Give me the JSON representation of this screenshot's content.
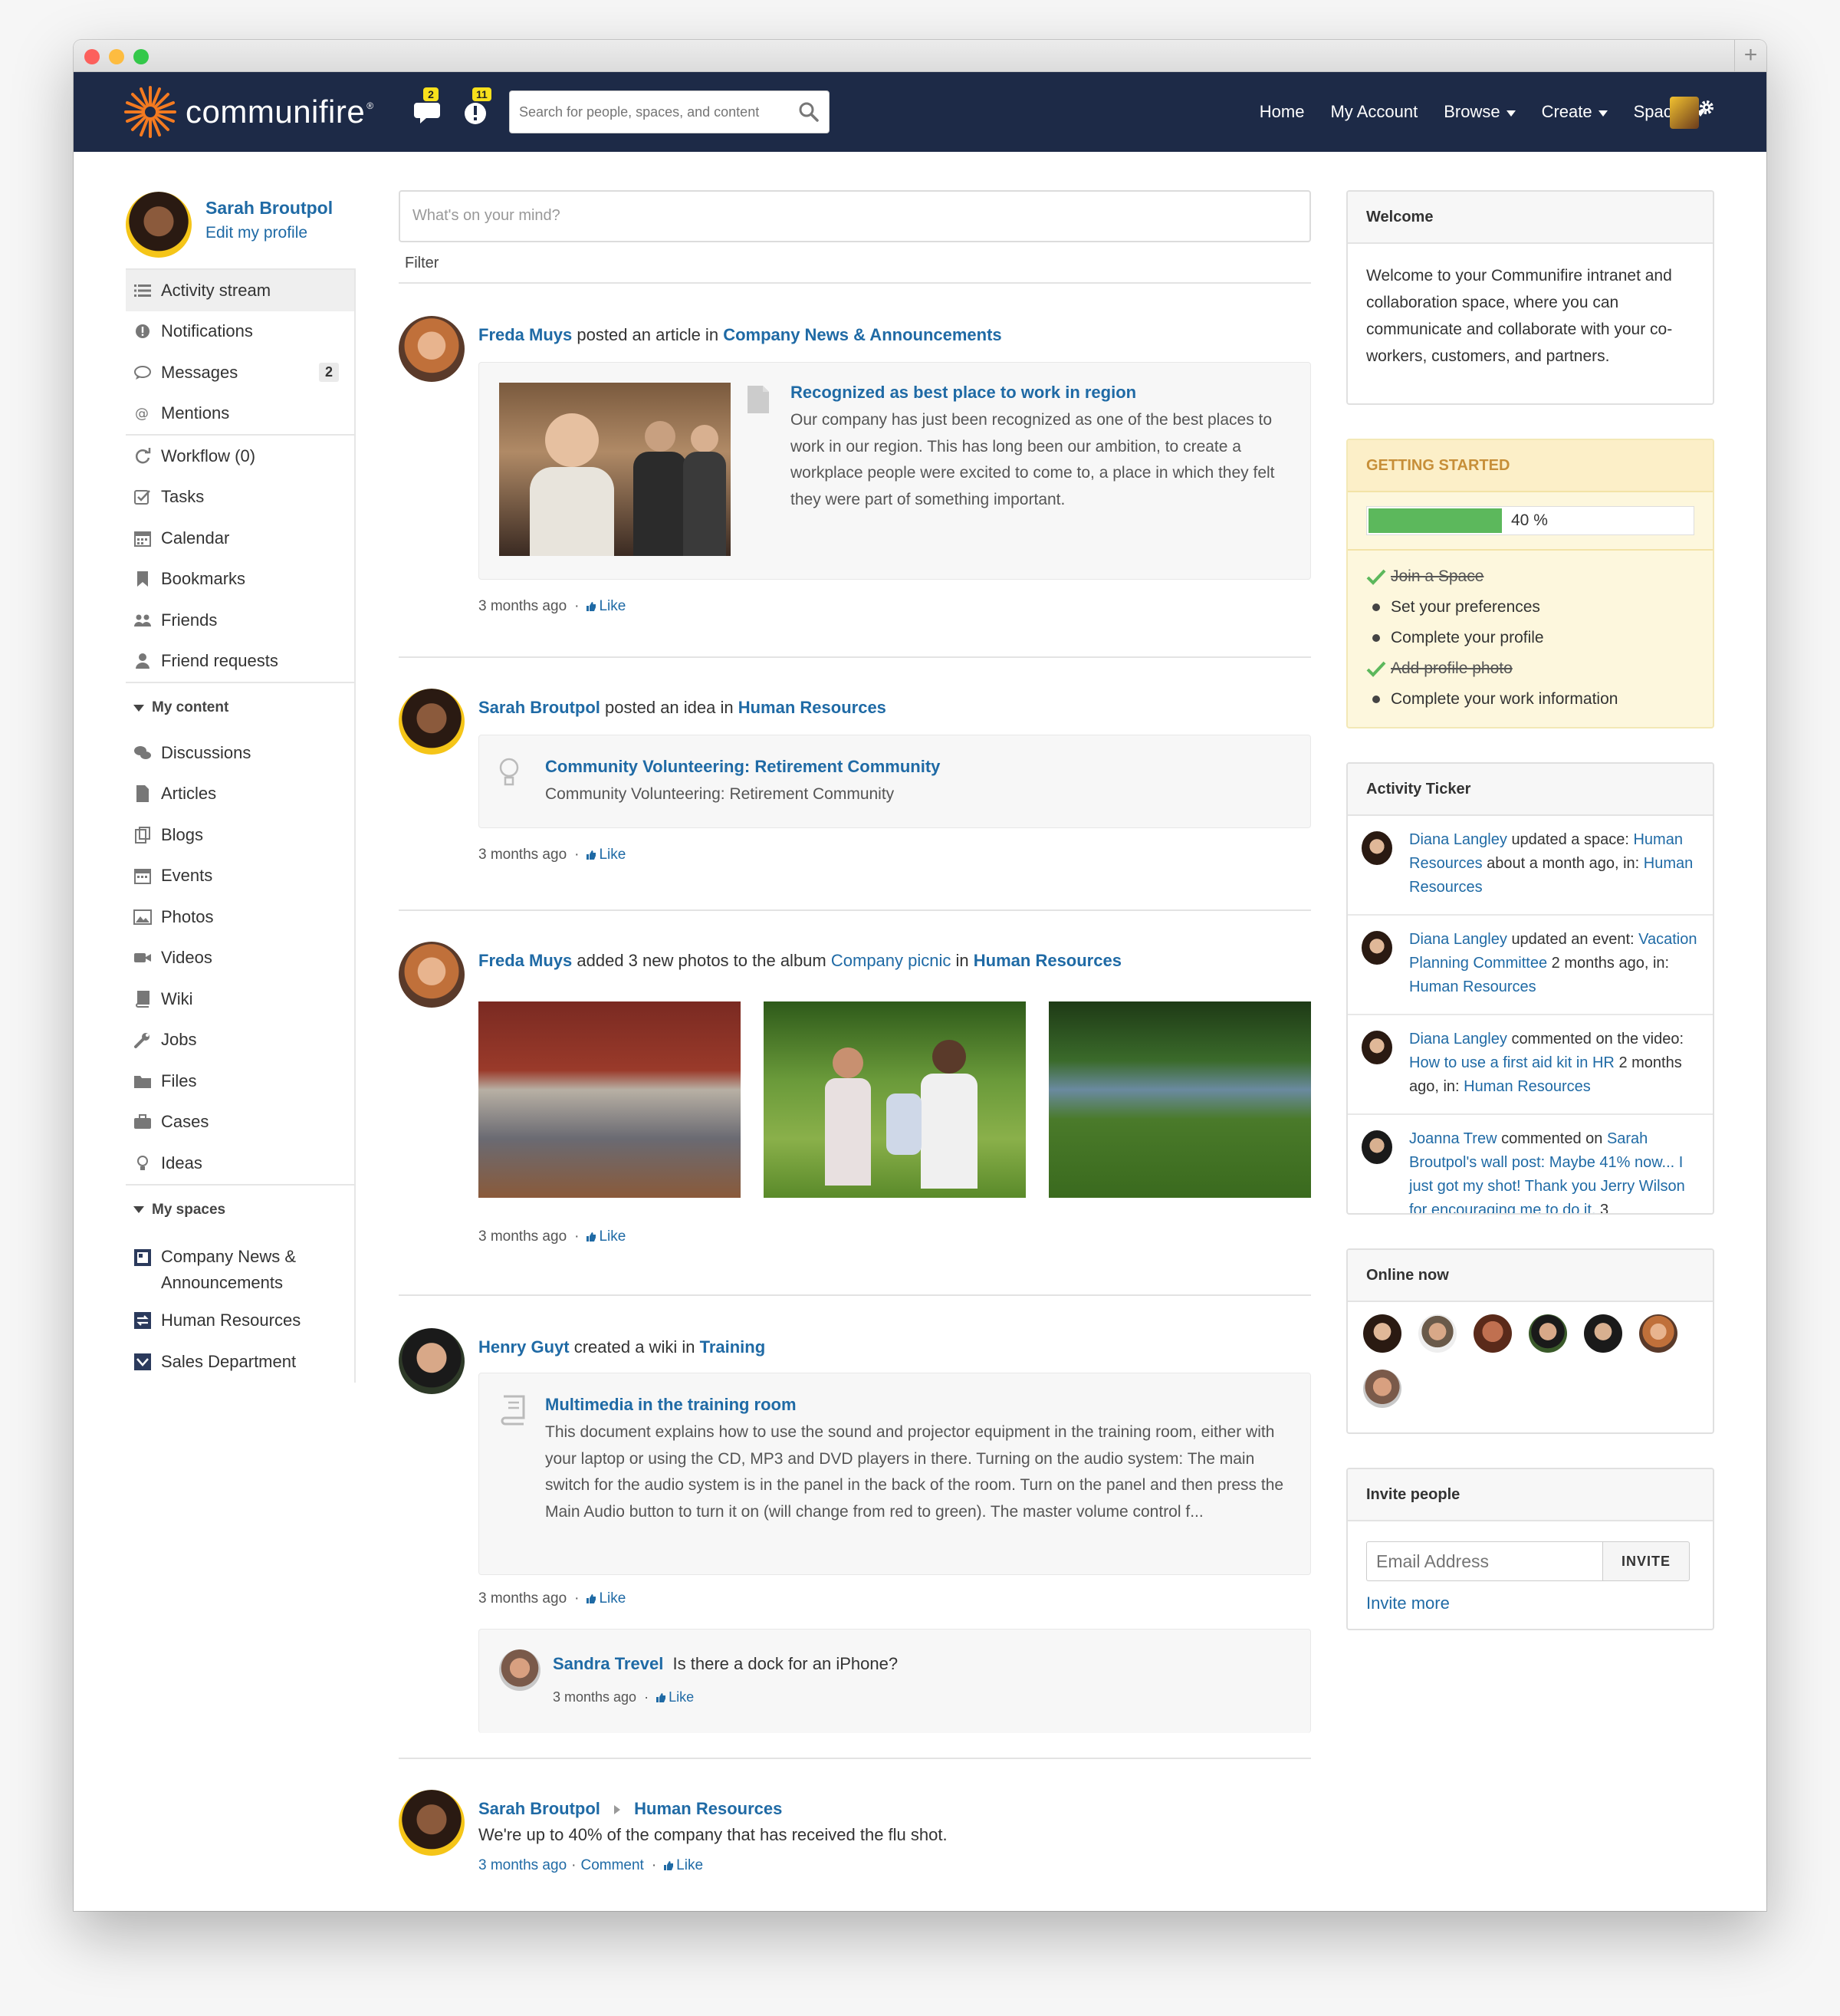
{
  "colors": {
    "navbar": "#1d2a47",
    "link": "#1f6aa5",
    "accent": "#f47a20",
    "progress": "#5cb85c",
    "badge": "#f8e01c"
  },
  "app": {
    "logo_text": "communifire",
    "logo_reg": "®",
    "messages_badge": "2",
    "notifications_badge": "11",
    "search_placeholder": "Search for people, spaces, and content",
    "nav": {
      "home": "Home",
      "my_account": "My Account",
      "browse": "Browse",
      "create": "Create",
      "spaces": "Spaces"
    }
  },
  "profile": {
    "name": "Sarah Broutpol",
    "edit": "Edit my profile"
  },
  "sidebar": {
    "main": [
      {
        "label": "Activity stream",
        "icon": "list-icon"
      },
      {
        "label": "Notifications",
        "icon": "alert-circle-icon"
      },
      {
        "label": "Messages",
        "icon": "chat-bubble-icon",
        "count": "2"
      },
      {
        "label": "Mentions",
        "icon": "at-icon"
      }
    ],
    "tools": [
      {
        "label": "Workflow (0)",
        "icon": "refresh-icon"
      },
      {
        "label": "Tasks",
        "icon": "check-square-icon"
      },
      {
        "label": "Calendar",
        "icon": "calendar-icon"
      },
      {
        "label": "Bookmarks",
        "icon": "bookmark-icon"
      },
      {
        "label": "Friends",
        "icon": "users-icon"
      },
      {
        "label": "Friend requests",
        "icon": "user-icon"
      }
    ],
    "my_content_heading": "My content",
    "content": [
      {
        "label": "Discussions",
        "icon": "comments-icon"
      },
      {
        "label": "Articles",
        "icon": "document-icon"
      },
      {
        "label": "Blogs",
        "icon": "blog-icon"
      },
      {
        "label": "Events",
        "icon": "calendar-icon"
      },
      {
        "label": "Photos",
        "icon": "picture-icon"
      },
      {
        "label": "Videos",
        "icon": "video-camera-icon"
      },
      {
        "label": "Wiki",
        "icon": "book-icon"
      },
      {
        "label": "Jobs",
        "icon": "wrench-icon"
      },
      {
        "label": "Files",
        "icon": "folder-icon"
      },
      {
        "label": "Cases",
        "icon": "briefcase-icon"
      },
      {
        "label": "Ideas",
        "icon": "lightbulb-icon"
      }
    ],
    "my_spaces_heading": "My spaces",
    "spaces": [
      {
        "label": "Company News & Announcements",
        "icon": "newspaper-icon"
      },
      {
        "label": "Human Resources",
        "icon": "hr-space-icon"
      },
      {
        "label": "Sales Department",
        "icon": "sales-space-icon"
      }
    ]
  },
  "feed": {
    "composer_placeholder": "What's on your mind?",
    "filter": "Filter",
    "posts": [
      {
        "actor": "Freda Muys",
        "verb": "posted an article in",
        "target": "Company News & Announcements",
        "card_title": "Recognized as best place to work in region",
        "card_body": "Our company has just been recognized as one of the best places to work in our region. This has long been our ambition, to create a workplace people were excited to come to, a place in which they felt they were part of something important.",
        "time": "3 months ago",
        "like": "Like"
      },
      {
        "actor": "Sarah Broutpol",
        "verb": "posted an idea in",
        "target": "Human Resources",
        "card_title": "Community Volunteering: Retirement Community",
        "card_body": "Community Volunteering: Retirement Community",
        "time": "3 months ago",
        "like": "Like"
      },
      {
        "actor": "Freda Muys",
        "verb": "added 3 new photos to the album",
        "album": "Company picnic",
        "in": "in",
        "target": "Human Resources",
        "time": "3 months ago",
        "like": "Like"
      },
      {
        "actor": "Henry Guyt",
        "verb": "created a wiki in",
        "target": "Training",
        "card_title": "Multimedia in the training room",
        "card_body": "This document explains how to use the sound and projector equipment in the training room, either with your laptop or using the CD, MP3 and DVD players in there. Turning on the audio system: The main switch for the audio system is in the panel in the back of the room. Turn on the panel and then press the Main Audio button to turn it on (will change from red to green). The master volume control f...",
        "time": "3 months ago",
        "like": "Like",
        "comment": {
          "author": "Sandra Trevel",
          "text": "Is there a dock for an iPhone?",
          "time": "3 months ago",
          "like": "Like"
        }
      },
      {
        "actor": "Sarah Broutpol",
        "target": "Human Resources",
        "text": "We're up to 40% of the company that has received the flu shot.",
        "time": "3 months ago",
        "comment": "Comment",
        "like": "Like"
      }
    ]
  },
  "welcome": {
    "title": "Welcome",
    "body": "Welcome to your Communifire intranet and collaboration space, where you can communicate and collaborate with your co-workers, customers, and partners."
  },
  "getting_started": {
    "title": "GETTING STARTED",
    "progress": 40,
    "progress_label": "40 %",
    "items": [
      {
        "label": "Join a Space",
        "done": true
      },
      {
        "label": "Set your preferences",
        "done": false
      },
      {
        "label": "Complete your profile",
        "done": false
      },
      {
        "label": "Add profile photo",
        "done": true
      },
      {
        "label": "Complete your work information",
        "done": false
      }
    ]
  },
  "ticker": {
    "title": "Activity Ticker",
    "items": [
      {
        "actor": "Diana Langley",
        "verb": "updated a space:",
        "object": "Human Resources",
        "time": "about a month ago, in:",
        "space": "Human Resources"
      },
      {
        "actor": "Diana Langley",
        "verb": "updated an event:",
        "object": "Vacation Planning Committee",
        "time": "2 months ago, in:",
        "space": "Human Resources"
      },
      {
        "actor": "Diana Langley",
        "verb": "commented on the video:",
        "object": "How to use a first aid kit in HR",
        "time": "2 months ago, in:",
        "space": "Human Resources"
      },
      {
        "actor": "Joanna Trew",
        "verb": "commented on",
        "object": "Sarah Broutpol's wall post: Maybe 41% now... I just got my shot! Thank you Jerry Wilson for encouraging me to do it.",
        "time": "3",
        "space": ""
      }
    ]
  },
  "online": {
    "title": "Online now"
  },
  "invite": {
    "title": "Invite people",
    "placeholder": "Email Address",
    "button": "INVITE",
    "more": "Invite more"
  }
}
